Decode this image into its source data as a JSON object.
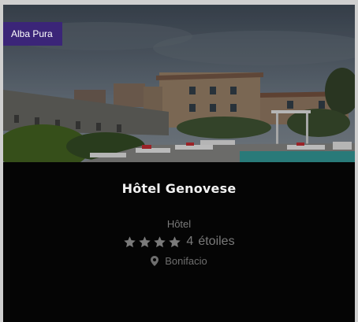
{
  "card": {
    "badge": "Alba Pura",
    "title": "Hôtel Genovese",
    "category": "Hôtel",
    "rating": {
      "stars": 4,
      "count_text": "4",
      "unit": "étoiles"
    },
    "location": {
      "icon": "map-pin-icon",
      "text": "Bonifacio"
    }
  },
  "colors": {
    "badge_bg": "#3b2578",
    "card_bg": "#050505",
    "muted_text": "#7a7a7a"
  }
}
